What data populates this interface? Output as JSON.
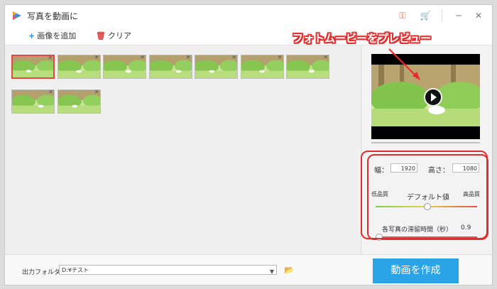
{
  "window": {
    "title": "写真を動画に"
  },
  "toolbar": {
    "add_label": "画像を追加",
    "clear_label": "クリア"
  },
  "thumbnails": {
    "count": 9,
    "selected_index": 0
  },
  "settings": {
    "width_label": "幅：",
    "width_value": "1920",
    "height_label": "高さ：",
    "height_value": "1080",
    "quality_low": "低品質",
    "quality_default": "デフォルト値",
    "quality_high": "高品質",
    "quality_level": 0.5,
    "duration_label": "各写真の滞留時間（秒）",
    "duration_value": "0.9",
    "duration_level": 0.03
  },
  "output": {
    "folder_label": "出力フォルダ：",
    "folder_value": "D:¥テスト",
    "create_label": "動画を作成"
  },
  "annotation": {
    "text": "フォトムービーをプレビュー"
  },
  "colors": {
    "accent": "#2aa4e6",
    "highlight": "#e42c2c"
  },
  "icons": [
    "app-icon",
    "key-icon",
    "cart-icon",
    "minimize-icon",
    "maximize-icon",
    "close-icon",
    "plus-icon",
    "trash-icon",
    "play-icon",
    "folder-icon",
    "dropdown-icon"
  ]
}
